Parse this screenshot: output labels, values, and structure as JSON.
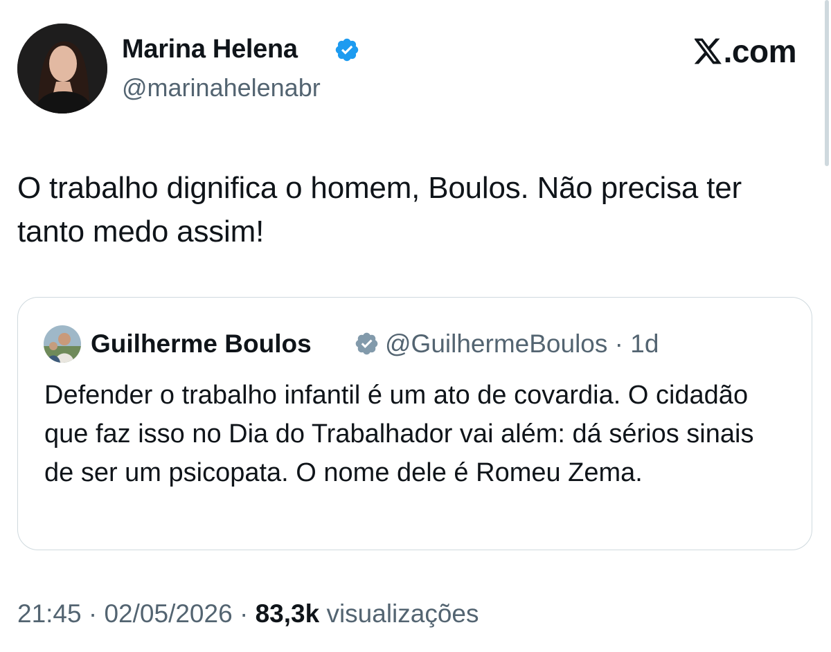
{
  "author": {
    "name": "Marina Helena",
    "handle": "@marinahelenabr"
  },
  "brand": {
    "label": ".com",
    "icon": "x-logo-icon"
  },
  "tweet": {
    "text": "O trabalho dignifica o homem, Boulos. Não precisa ter tanto medo assim!"
  },
  "quoted": {
    "name": "Guilherme Boulos",
    "handle": "@GuilhermeBoulos",
    "separator": "·",
    "time": "1d",
    "text": "Defender o trabalho infantil é um ato de covardia. O cidadão que faz isso no Dia do Trabalhador vai além: dá sérios sinais de ser um psicopata. O nome dele é Romeu Zema."
  },
  "footer": {
    "time": "21:45",
    "separator": "·",
    "date": "02/05/2026",
    "views_count": "83,3k",
    "views_label": "visualizações"
  },
  "colors": {
    "verified": "#1d9bf0",
    "verified_quote": "#829aab",
    "text": "#0f1419",
    "secondary": "#536471",
    "border": "#cfd9de"
  }
}
